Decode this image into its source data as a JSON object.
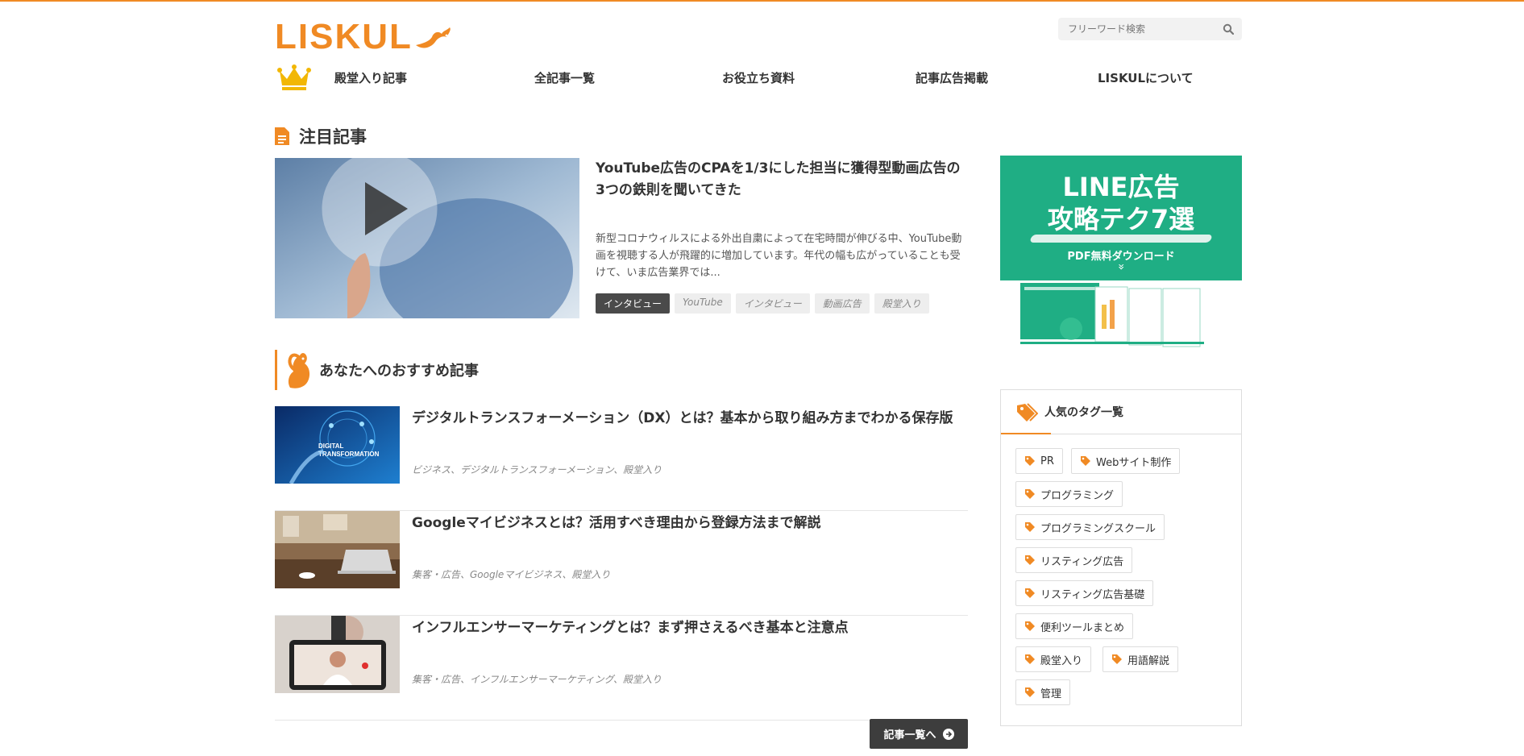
{
  "header": {
    "logo_text": "LISKUL",
    "search": {
      "placeholder": "フリーワード検索"
    }
  },
  "nav": {
    "items": [
      {
        "label": "殿堂入り記事"
      },
      {
        "label": "全記事一覧"
      },
      {
        "label": "お役立ち資料"
      },
      {
        "label": "記事広告掲載"
      },
      {
        "label": "LISKULについて"
      }
    ]
  },
  "featured": {
    "section_title": "注目記事",
    "title": "YouTube広告のCPAを1/3にした担当に獲得型動画広告の3つの鉄則を聞いてきた",
    "description": "新型コロナウィルスによる外出自粛によって在宅時間が伸びる中、YouTube動画を視聴する人が飛躍的に増加しています。年代の幅も広がっていることも受けて、いま広告業界では...",
    "tags": [
      "インタビュー",
      "YouTube",
      "インタビュー",
      "動画広告",
      "殿堂入り"
    ]
  },
  "recommended": {
    "section_title": "あなたへのおすすめ記事",
    "items": [
      {
        "title": "デジタルトランスフォーメーション（DX）とは？基本から取り組み方までわかる保存版",
        "categories": "ビジネス、デジタルトランスフォーメーション、殿堂入り",
        "thumb_text": "DIGITAL TRANSFORMATION"
      },
      {
        "title": "Googleマイビジネスとは？活用すべき理由から登録方法まで解説",
        "categories": "集客・広告、Googleマイビジネス、殿堂入り"
      },
      {
        "title": "インフルエンサーマーケティングとは？まず押さえるべき基本と注意点",
        "categories": "集客・広告、インフルエンサーマーケティング、殿堂入り"
      }
    ],
    "more_label": "記事一覧へ"
  },
  "sidebar": {
    "banner": {
      "line1": "LINE広告",
      "line2": "攻略テク7選",
      "line3": "PDF無料ダウンロード",
      "arrow": "»"
    },
    "tags_title": "人気のタグ一覧",
    "tags": [
      "PR",
      "Webサイト制作",
      "プログラミング",
      "プログラミングスクール",
      "リスティング広告",
      "リスティング広告基礎",
      "便利ツールまとめ",
      "殿堂入り",
      "用語解説",
      "管理"
    ]
  },
  "colors": {
    "brand": "#f08a24",
    "banner_green": "#1fae84",
    "dark_button": "#3d3d3d"
  }
}
